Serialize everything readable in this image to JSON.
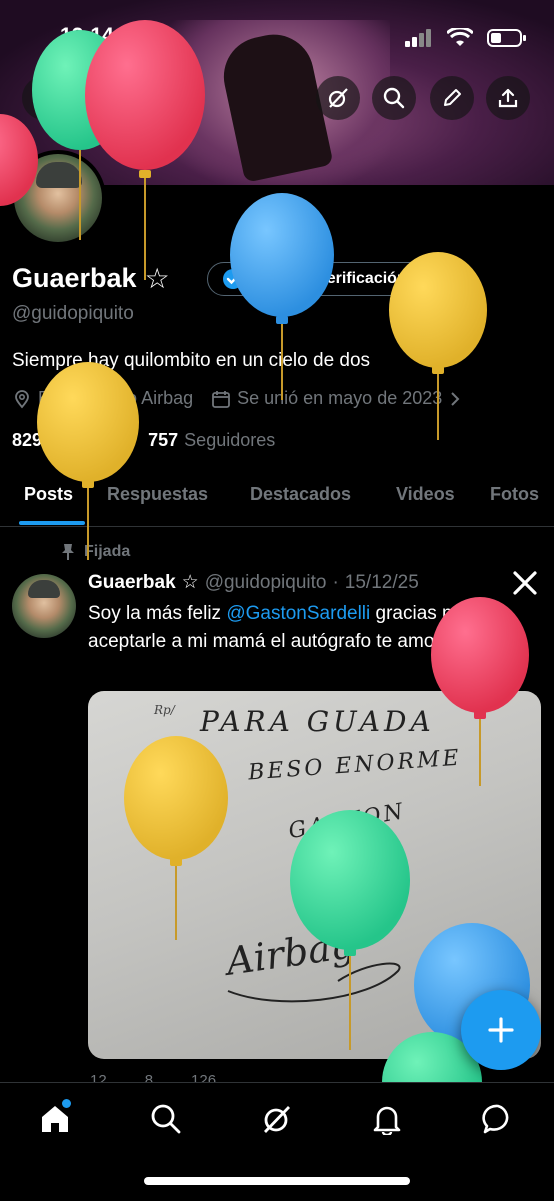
{
  "status_bar": {
    "time": "12:14"
  },
  "profile": {
    "display_name": "Guaerbak",
    "name_badge": "☆",
    "handle": "@guidopiquito",
    "verify_label": "Obtener verificación",
    "bio": "Siempre hay quilombito en un cielo de dos",
    "location": "Escuchando Airbag",
    "joined": "Se unió en mayo de 2023",
    "following_count": "829",
    "following_label": "Siguiendo",
    "followers_count": "757",
    "followers_label": "Seguidores"
  },
  "tabs": [
    "Posts",
    "Respuestas",
    "Destacados",
    "Videos",
    "Fotos"
  ],
  "pinned_post": {
    "pinned_label": "Fijada",
    "author": "Guaerbak",
    "author_badge": "☆",
    "handle": "@guidopiquito",
    "separator": "·",
    "date": "15/12/25",
    "text_before": "Soy la más feliz ",
    "mention": "@GastonSardelli",
    "text_after": " gracias por aceptarle a mi mamá el autógrafo te amo 🥵😭😭",
    "image_note_lines": [
      "Rp/",
      "PARA GUADA",
      "UN",
      "BESO ENORME",
      "GASTON",
      "Airbag"
    ],
    "stats": {
      "replies": "12",
      "reposts": "8",
      "likes": "126"
    }
  },
  "colors": {
    "accent": "#1d9bf0",
    "background": "#000000",
    "muted": "#71767b"
  },
  "icons": {
    "back": "arrow-left-icon",
    "grok": "grok-icon",
    "search": "search-icon",
    "edit": "pencil-icon",
    "share": "share-icon",
    "x_logo": "x-logo-icon",
    "compose": "plus-icon",
    "nav": [
      "home-icon",
      "search-icon",
      "grok-icon",
      "bell-icon",
      "chat-icon"
    ]
  }
}
